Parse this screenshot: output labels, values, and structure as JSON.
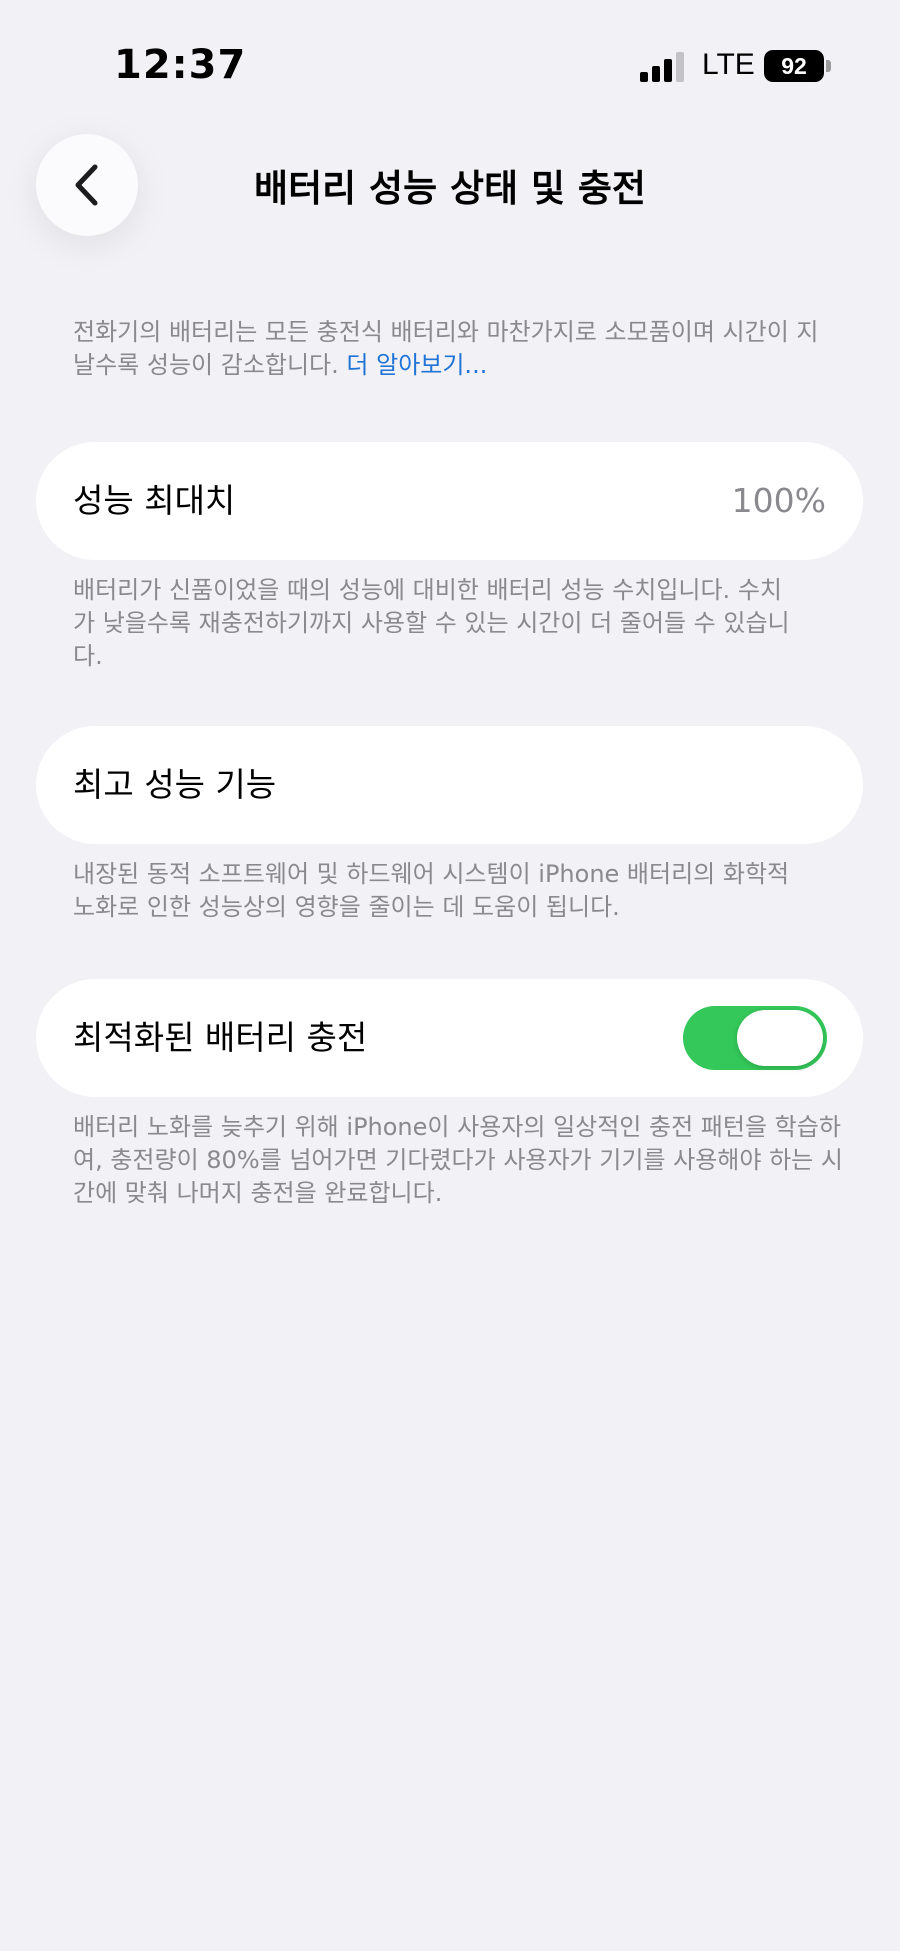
{
  "status_bar": {
    "time": "12:37",
    "network": "LTE",
    "battery_level": "92",
    "signal_bars": 3,
    "signal_bars_total": 4
  },
  "header": {
    "title": "배터리 성능 상태 및 충전",
    "back_icon": "chevron-left-icon"
  },
  "intro": {
    "text": "전화기의 배터리는 모든 충전식 배터리와 마찬가지로 소모품이며 시간이 지날수록 성능이 감소합니다. ",
    "link": "더 알아보기..."
  },
  "sections": {
    "max_capacity": {
      "label": "성능 최대치",
      "value": "100%",
      "footnote": "배터리가 신품이었을 때의 성능에 대비한 배터리 성능 수치입니다. 수치가 낮을수록 재충전하기까지 사용할 수 있는 시간이 더 줄어들 수 있습니다."
    },
    "peak_performance": {
      "label": "최고 성능 기능",
      "footnote": "내장된 동적 소프트웨어 및 하드웨어 시스템이 iPhone 배터리의 화학적 노화로 인한 성능상의 영향을 줄이는 데 도움이 됩니다."
    },
    "optimized_charging": {
      "label": "최적화된 배터리 충전",
      "enabled": true,
      "footnote": "배터리 노화를 늦추기 위해 iPhone이 사용자의 일상적인 충전 패턴을 학습하여, 충전량이 80%를 넘어가면 기다렸다가 사용자가 기기를 사용해야 하는 시간에 맞춰 나머지 충전을 완료합니다."
    }
  },
  "colors": {
    "background": "#f1f1f6",
    "toggle_on": "#34c759",
    "link": "#1f74d6",
    "secondary_text": "#8a8a8e"
  }
}
